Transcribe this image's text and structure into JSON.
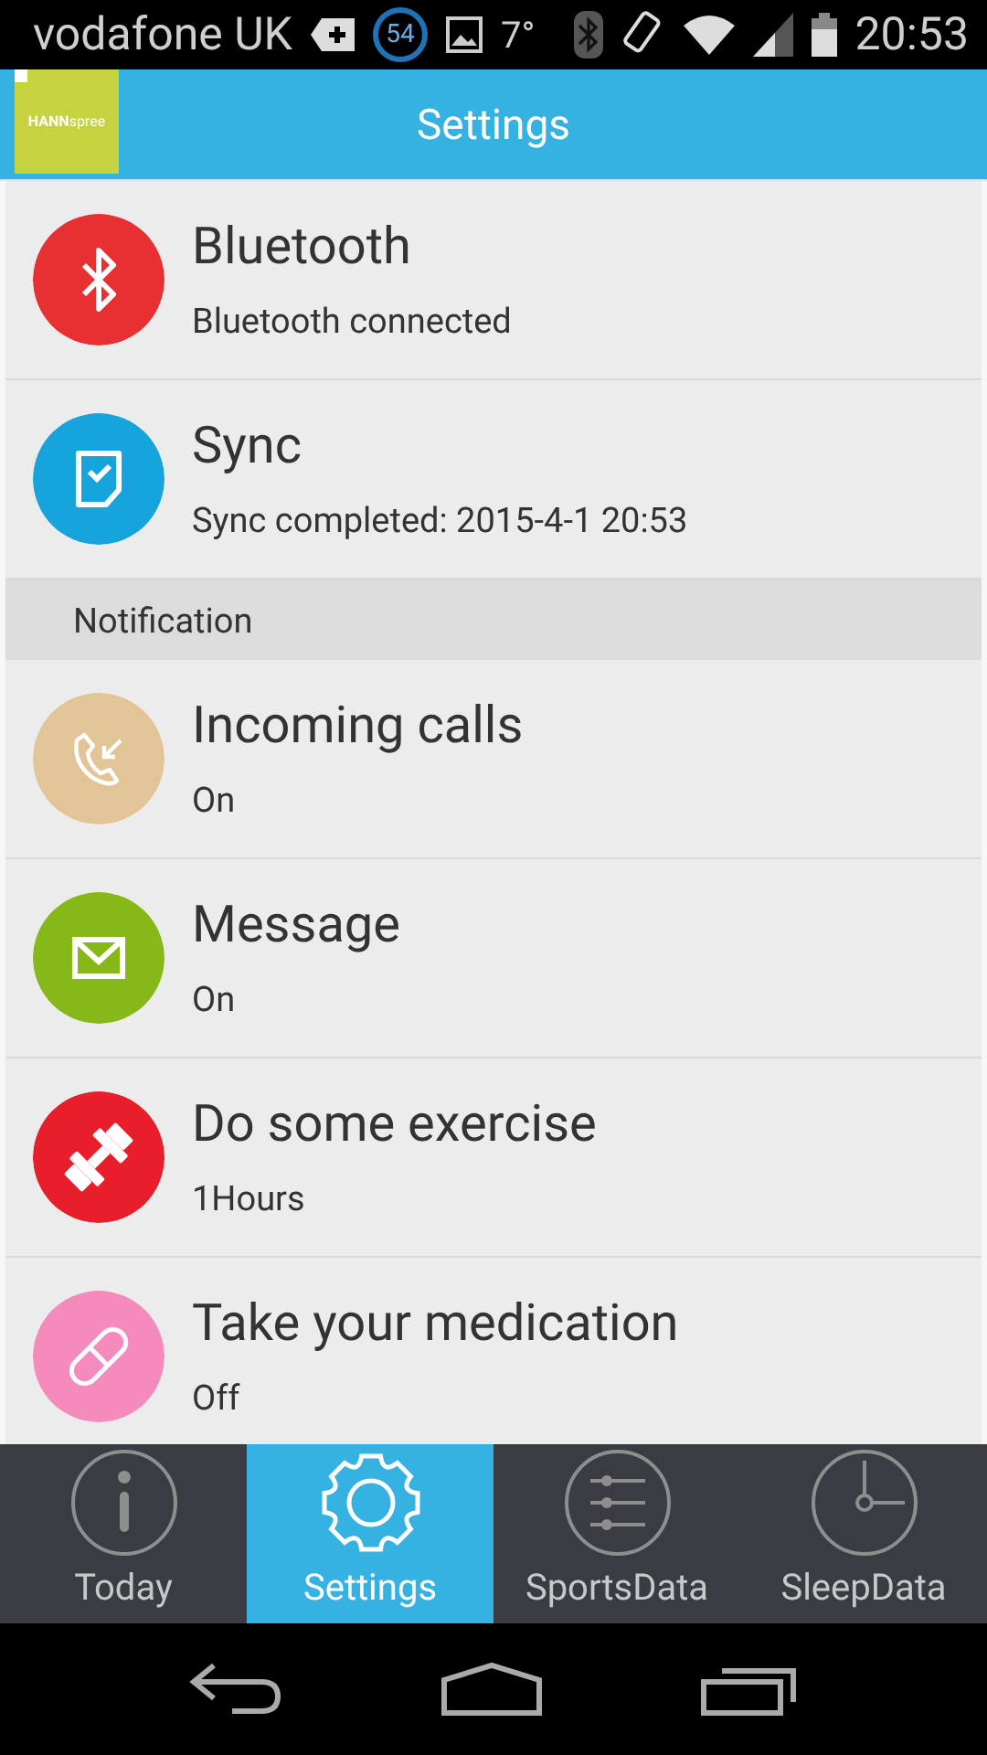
{
  "status_bar": {
    "carrier": "vodafone UK",
    "badge": "54",
    "temperature": "7°",
    "time": "20:53"
  },
  "app_bar": {
    "logo": "**HANN**spree",
    "title": "Settings"
  },
  "settings": [
    {
      "kind": "item",
      "title": "Bluetooth",
      "subtitle": "Bluetooth connected",
      "color": "#e83033"
    },
    {
      "kind": "item",
      "title": "Sync",
      "subtitle": "Sync completed: 2015-4-1 20:53",
      "color": "#17a3dc"
    },
    {
      "kind": "header",
      "title": "Notification"
    },
    {
      "kind": "item",
      "title": "Incoming calls",
      "subtitle": "On",
      "color": "#e2c597"
    },
    {
      "kind": "item",
      "title": "Message",
      "subtitle": "On",
      "color": "#86b817"
    },
    {
      "kind": "item",
      "title": "Do some exercise",
      "subtitle": "1Hours",
      "color": "#ea1e2a"
    },
    {
      "kind": "item",
      "title": "Take your medication",
      "subtitle": "Off",
      "color": "#f58bbd"
    }
  ],
  "tabs": [
    {
      "label": "Today",
      "selected": false
    },
    {
      "label": "Settings",
      "selected": true
    },
    {
      "label": "SportsData",
      "selected": false
    },
    {
      "label": "SleepData",
      "selected": false
    }
  ]
}
